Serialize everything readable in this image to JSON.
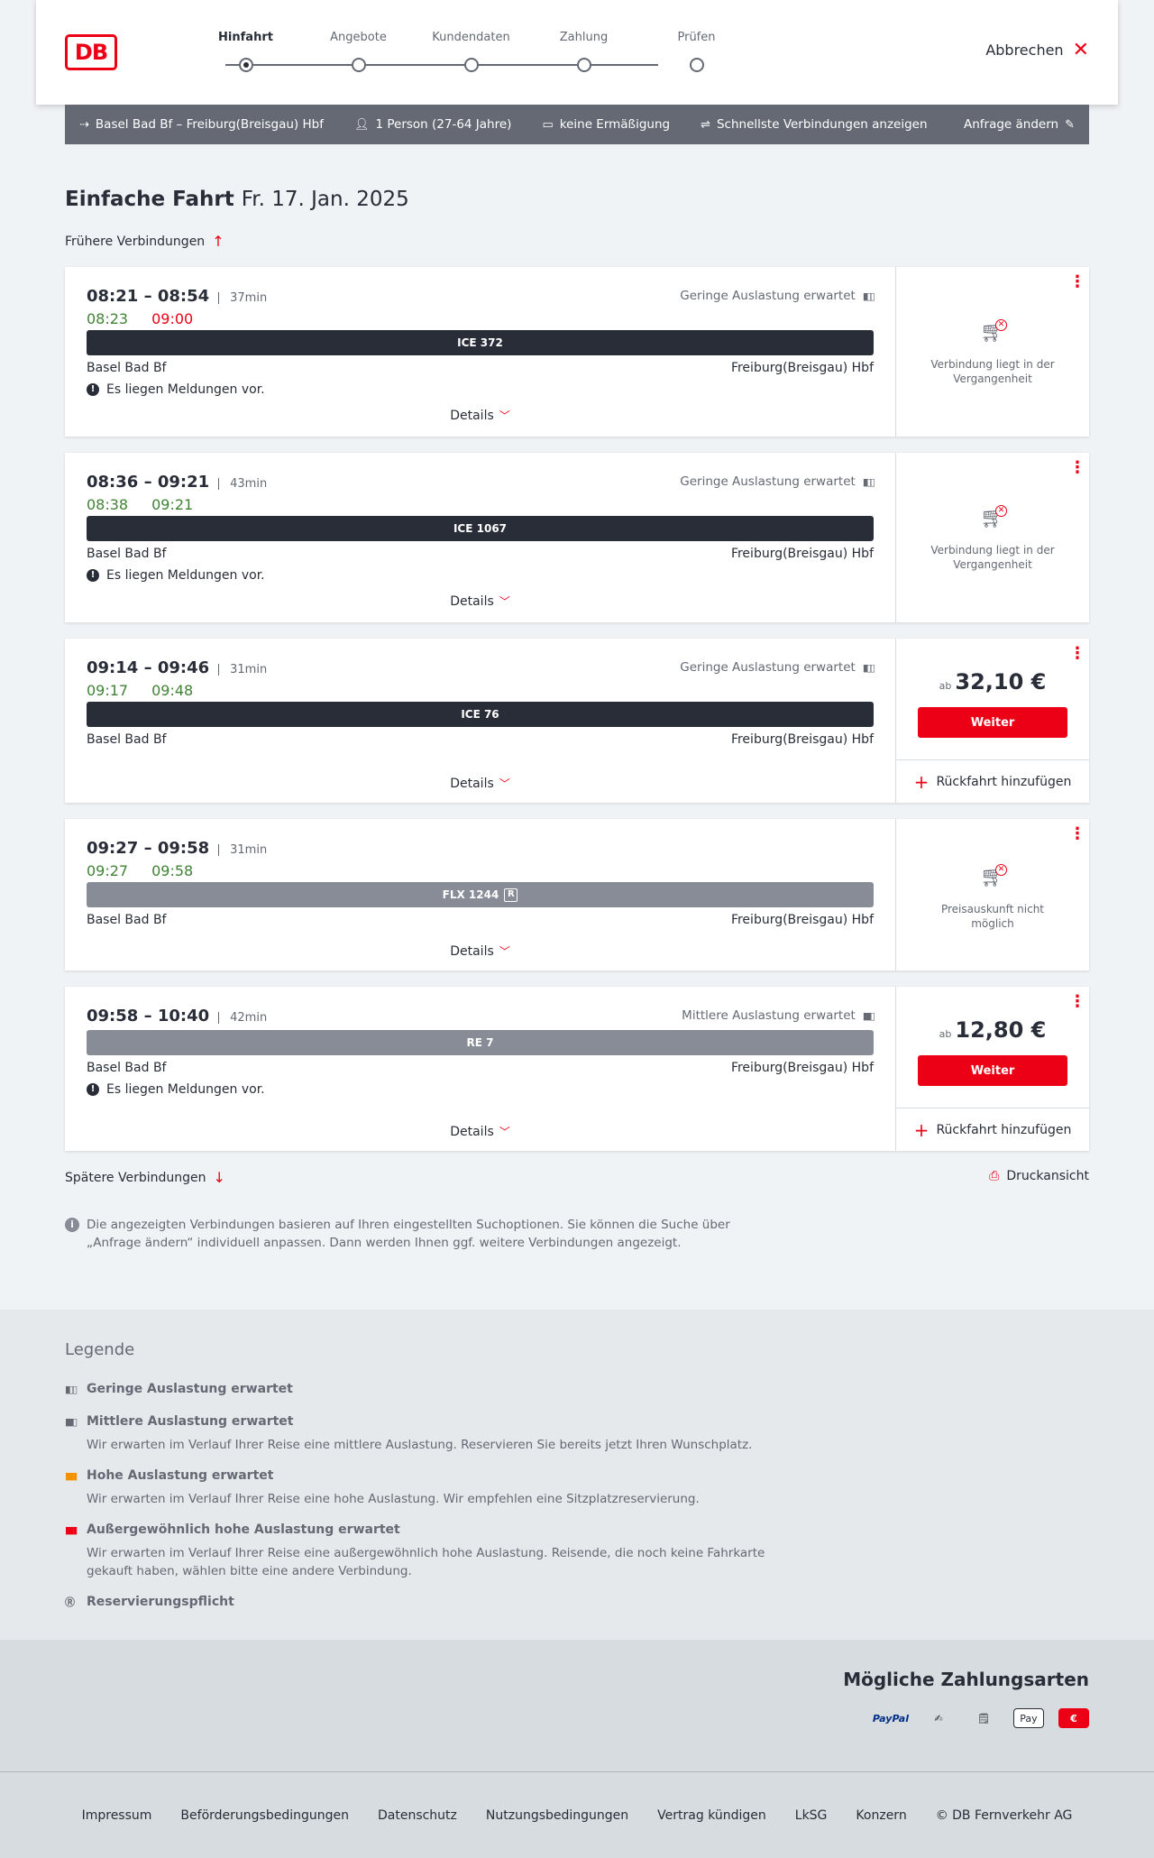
{
  "header": {
    "logo": "DB",
    "steps": [
      "Hinfahrt",
      "Angebote",
      "Kundendaten",
      "Zahlung",
      "Prüfen"
    ],
    "active_step": "Hinfahrt",
    "cancel_label": "Abbrechen"
  },
  "search": {
    "route": "Basel Bad Bf – Freiburg(Breisgau) Hbf",
    "passengers": "1 Person (27-64 Jahre)",
    "discount": "keine Ermäßigung",
    "option": "Schnellste Verbindungen anzeigen",
    "change": "Anfrage ändern"
  },
  "page": {
    "title": "Einfache Fahrt",
    "date": "Fr. 17. Jan. 2025",
    "earlier": "Frühere Verbindungen",
    "later": "Spätere Verbindungen",
    "print": "Druckansicht",
    "info": "Die angezeigten Verbindungen basieren auf Ihren eingestellten Suchoptionen. Sie können die Suche über „Anfrage ändern“ individuell anpassen. Dann werden Ihnen ggf. weitere Verbindungen angezeigt.",
    "details_label": "Details",
    "message_label": "Es liegen Meldungen vor.",
    "from_label": "ab",
    "weiter_label": "Weiter",
    "return_label": "Rückfahrt hinzufügen"
  },
  "connections": [
    {
      "times": "08:21 – 08:54",
      "duration": "37min",
      "rt_dep": "08:23",
      "rt_arr": "09:00",
      "rt_arr_late": true,
      "load": "Geringe Auslastung erwartet",
      "train": "ICE 372",
      "train_style": "dark",
      "from": "Basel Bad Bf",
      "to": "Freiburg(Breisgau) Hbf",
      "message": true,
      "side": "Verbindung liegt in der Vergangenheit"
    },
    {
      "times": "08:36 – 09:21",
      "duration": "43min",
      "rt_dep": "08:38",
      "rt_arr": "09:21",
      "rt_arr_late": false,
      "load": "Geringe Auslastung erwartet",
      "train": "ICE 1067",
      "train_style": "dark",
      "from": "Basel Bad Bf",
      "to": "Freiburg(Breisgau) Hbf",
      "message": true,
      "side": "Verbindung liegt in der Vergangenheit"
    },
    {
      "times": "09:14 – 09:46",
      "duration": "31min",
      "rt_dep": "09:17",
      "rt_arr": "09:48",
      "rt_arr_late": false,
      "load": "Geringe Auslastung erwartet",
      "train": "ICE 76",
      "train_style": "dark",
      "from": "Basel Bad Bf",
      "to": "Freiburg(Breisgau) Hbf",
      "message": false,
      "price": "32,10 €"
    },
    {
      "times": "09:27 – 09:58",
      "duration": "31min",
      "rt_dep": "09:27",
      "rt_arr": "09:58",
      "rt_arr_late": false,
      "load": "",
      "train": "FLX 1244",
      "train_style": "grey",
      "reservation_icon": "R",
      "from": "Basel Bad Bf",
      "to": "Freiburg(Breisgau) Hbf",
      "message": false,
      "side": "Preisauskunft nicht möglich"
    },
    {
      "times": "09:58 – 10:40",
      "duration": "42min",
      "load": "Mittlere Auslastung erwartet",
      "train": "RE 7",
      "train_style": "grey",
      "from": "Basel Bad Bf",
      "to": "Freiburg(Breisgau) Hbf",
      "message": true,
      "price": "12,80 €"
    }
  ],
  "legend": {
    "title": "Legende",
    "items": [
      {
        "title": "Geringe Auslastung erwartet",
        "desc": "",
        "icon_color": "#646973"
      },
      {
        "title": "Mittlere Auslastung erwartet",
        "desc": "Wir erwarten im Verlauf Ihrer Reise eine mittlere Auslastung. Reservieren Sie bereits jetzt Ihren Wunschplatz.",
        "icon_color": "#646973"
      },
      {
        "title": "Hohe Auslastung erwartet",
        "desc": "Wir erwarten im Verlauf Ihrer Reise eine hohe Auslastung. Wir empfehlen eine Sitzplatzreservierung.",
        "icon_color": "#f39200"
      },
      {
        "title": "Außergewöhnlich hohe Auslastung erwartet",
        "desc": "Wir erwarten im Verlauf Ihrer Reise eine außergewöhnlich hohe Auslastung. Reisende, die noch keine Fahrkarte gekauft haben, wählen bitte eine andere Verbindung.",
        "icon_color": "#ec0016"
      },
      {
        "title": "Reservierungspflicht",
        "desc": "",
        "icon_color": "#646973"
      }
    ]
  },
  "payment": {
    "title": "Mögliche Zahlungsarten",
    "methods": [
      "PayPal",
      "Kreditkarte",
      "SEPA",
      "Apple Pay",
      "DB"
    ]
  },
  "footer": {
    "links": [
      "Impressum",
      "Beförderungsbedingungen",
      "Datenschutz",
      "Nutzungsbedingungen",
      "Vertrag kündigen",
      "LkSG",
      "Konzern",
      "© DB Fernverkehr AG"
    ]
  },
  "colors": {
    "accent": "#ec0016",
    "realtime_ok": "#408335",
    "bar_dark": "#282d37",
    "bar_grey": "#878c96"
  }
}
